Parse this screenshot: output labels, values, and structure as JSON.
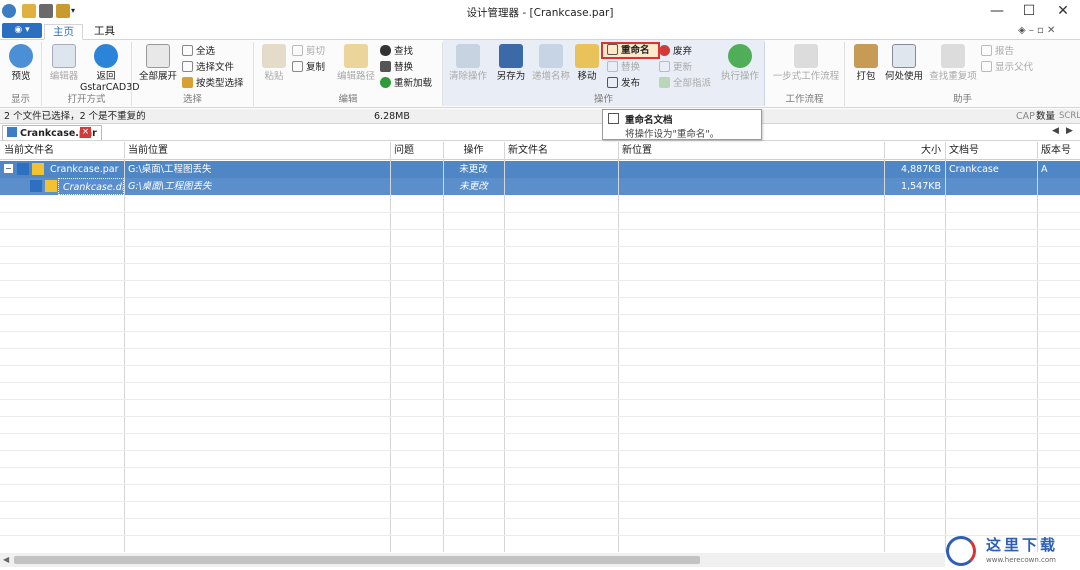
{
  "titlebar": {
    "title": "设计管理器 - [Crankcase.par]",
    "minimize": "—",
    "maximize": "☐",
    "close": "✕"
  },
  "menu": {
    "tabs": [
      "主页",
      "工具"
    ],
    "help_icons": "◈  –  ▫  ✕"
  },
  "ribbon": {
    "display": {
      "label": "显示",
      "preview": "预览"
    },
    "open_method": {
      "label": "打开方式",
      "editor": "编辑器",
      "back": "返回",
      "back2": "GstarCAD3D"
    },
    "select": {
      "label": "选择",
      "expand_all": "全部展开",
      "select_all": "全选",
      "select_file": "选择文件",
      "select_by_type": "按类型选择"
    },
    "edit": {
      "label": "编辑",
      "paste": "粘贴",
      "cut": "剪切",
      "copy": "复制",
      "edit_path": "编辑路径",
      "find": "查找",
      "replace": "替换",
      "reload": "重新加载"
    },
    "operate": {
      "label": "操作",
      "clear": "清除操作",
      "save_as": "另存为",
      "increment": "递增名称",
      "move": "移动",
      "rename": "重命名",
      "replace": "替换",
      "publish": "发布",
      "discard": "废弃",
      "update": "更新",
      "assign_all": "全部指派",
      "execute": "执行操作"
    },
    "workflow": {
      "label": "工作流程",
      "one_step": "一步式工作流程"
    },
    "helper": {
      "label": "助手",
      "pack": "打包",
      "where_used": "何处使用",
      "find_dup": "查找重复项",
      "report": "报告",
      "show_parent": "显示父代"
    }
  },
  "tooltip": {
    "title": "重命名文档",
    "desc": "将操作设为\"重命名\"。"
  },
  "status": {
    "selection": "2 个文件已选择，2 个是不重复的",
    "size": "6.28MB",
    "cap": "CAP",
    "num": "数量",
    "scrl": "SCRL"
  },
  "doc_tab": {
    "name": "Crankcase.par",
    "close": "×"
  },
  "grid": {
    "headers": [
      "当前文件名",
      "当前位置",
      "问题",
      "操作",
      "新文件名",
      "新位置",
      "大小",
      "文档号",
      "版本号"
    ],
    "rows": [
      {
        "name": "Crankcase.par",
        "path": "G:\\桌面\\工程图丢失",
        "issue": "",
        "action": "未更改",
        "newname": "",
        "newpath": "",
        "size": "4,887KB",
        "docno": "Crankcase",
        "rev": "A"
      },
      {
        "name": "Crankcase.dft",
        "path": "G:\\桌面\\工程图丢失",
        "issue": "",
        "action": "未更改",
        "newname": "",
        "newpath": "",
        "size": "1,547KB",
        "docno": "",
        "rev": ""
      }
    ]
  },
  "watermark": {
    "text": "这里下载",
    "url": "www.herecown.com"
  },
  "colors": {
    "accent": "#2b6fc2",
    "selected_row": "#4f86c6",
    "highlight": "#d83434"
  }
}
